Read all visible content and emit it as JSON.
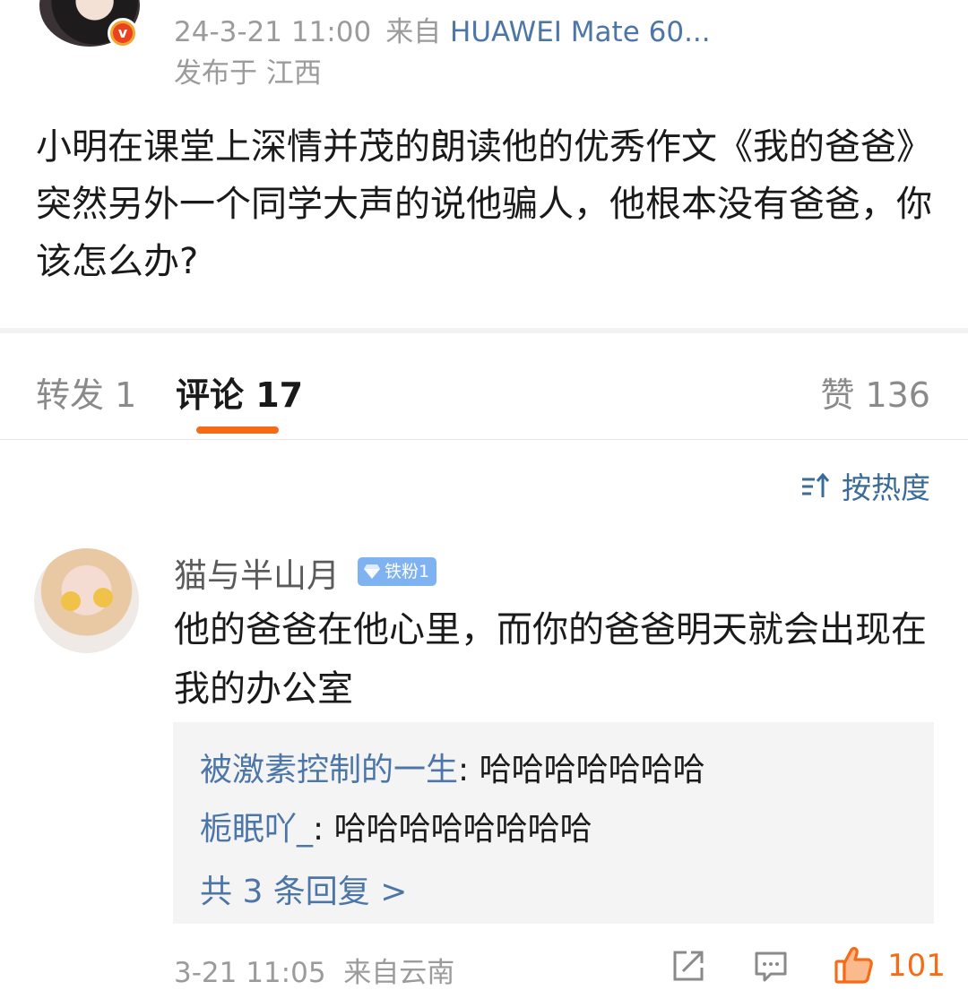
{
  "post": {
    "timestamp": "24-3-21 11:00",
    "source_prefix": "来自",
    "device": "HUAWEI Mate 60...",
    "location": "发布于 江西",
    "badge": "v",
    "content": "小明在课堂上深情并茂的朗读他的优秀作文《我的爸爸》突然另外一个同学大声的说他骗人，他根本没有爸爸，你该怎么办?"
  },
  "tabs": {
    "repost": "转发 1",
    "comment": "评论 17",
    "like": "赞 136"
  },
  "sort": {
    "label": "按热度",
    "icon": "sort-icon"
  },
  "comment": {
    "username": "猫与半山月",
    "fan_badge": "铁粉1",
    "text": "他的爸爸在他心里，而你的爸爸明天就会出现在我的办公室",
    "replies": [
      {
        "user": "被激素控制的一生",
        "text": ": 哈哈哈哈哈哈哈"
      },
      {
        "user": "栀眠吖_",
        "text": ": 哈哈哈哈哈哈哈哈"
      }
    ],
    "more_replies": "共 3 条回复 >",
    "time": "3-21 11:05",
    "location": "来自云南",
    "like_count": "101"
  },
  "colors": {
    "accent_orange": "#f56b16",
    "link_blue": "#4d76a8",
    "meta_gray": "#9b9b9b"
  }
}
